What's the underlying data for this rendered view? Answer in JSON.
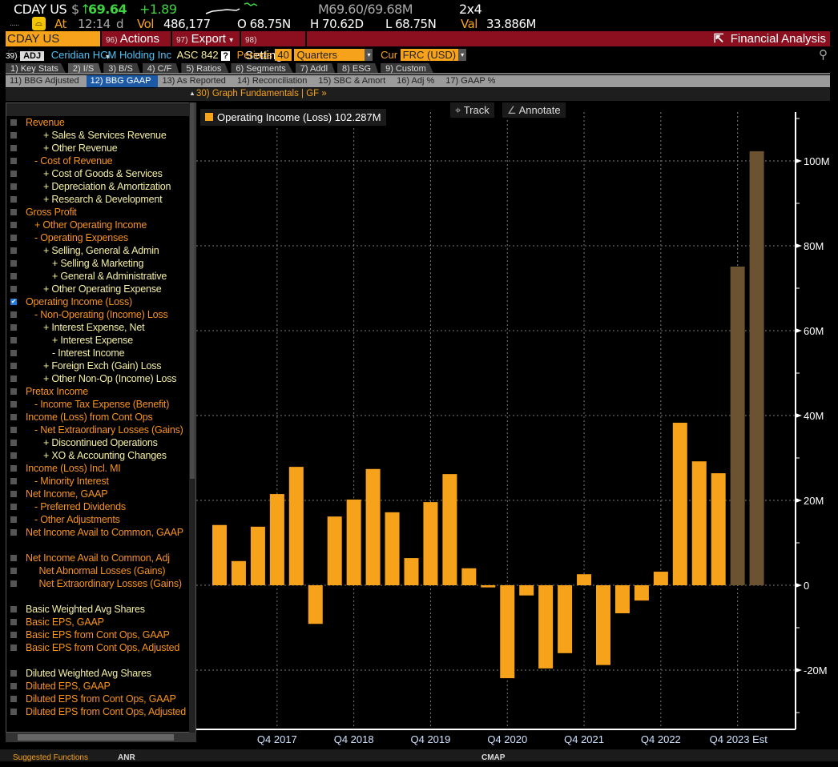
{
  "quote": {
    "ticker": "CDAY US",
    "currency_symbol": "$",
    "last": "69.64",
    "change": "+1.89",
    "bid_ask": "M69.60/69.68M",
    "size": "2x4",
    "time_label": "At",
    "time": "12:14",
    "time_suffix": "d",
    "vol_label": "Vol",
    "volume": "486,177",
    "open": "O 68.75N",
    "high": "H 70.62D",
    "low": "L 68.75N",
    "val_label": "Val",
    "value": "33.886M"
  },
  "toolbar": {
    "security": "CDAY US Equity",
    "actions_num": "96)",
    "actions": "Actions",
    "export_num": "97)",
    "export": "Export",
    "settings_num": "98)",
    "settings": "Settings",
    "fa": "Financial Analysis"
  },
  "info": {
    "num": "39)",
    "adj": "ADJ",
    "company": "Ceridian HCM Holding Inc",
    "asc": "ASC 842",
    "help": "?",
    "periods_label": "Periods",
    "periods": "40",
    "period_type": "Quarters",
    "cur_label": "Cur",
    "currency": "FRC (USD)"
  },
  "tabs": [
    "1) Key Stats",
    "2) I/S",
    "3) B/S",
    "4) C/F",
    "5) Ratios",
    "6) Segments",
    "7) Addl",
    "8) ESG",
    "9) Custom"
  ],
  "active_tab": 1,
  "subtabs": [
    "11) BBG Adjusted",
    "12) BBG GAAP",
    "13) As Reported",
    "14) Reconciliation",
    "15) SBC & Amort",
    "16) Adj %",
    "17) GAAP %"
  ],
  "active_subtab": 1,
  "graph_link": "30) Graph Fundamentals | GF »",
  "sidebar": [
    {
      "label": "Revenue",
      "lvl": 0,
      "c": "or"
    },
    {
      "label": "+ Sales & Services Revenue",
      "lvl": 2,
      "c": "ye"
    },
    {
      "label": "+ Other Revenue",
      "lvl": 2,
      "c": "ye"
    },
    {
      "label": "- Cost of Revenue",
      "lvl": 1,
      "c": "or"
    },
    {
      "label": "+ Cost of Goods & Services",
      "lvl": 2,
      "c": "ye"
    },
    {
      "label": "+ Depreciation & Amortization",
      "lvl": 2,
      "c": "ye"
    },
    {
      "label": "+ Research & Development",
      "lvl": 2,
      "c": "ye"
    },
    {
      "label": "Gross Profit",
      "lvl": 0,
      "c": "or"
    },
    {
      "label": "+ Other Operating Income",
      "lvl": 1,
      "c": "or"
    },
    {
      "label": "- Operating Expenses",
      "lvl": 1,
      "c": "or"
    },
    {
      "label": "+ Selling, General & Admin",
      "lvl": 2,
      "c": "ye"
    },
    {
      "label": "+ Selling & Marketing",
      "lvl": 3,
      "c": "ye"
    },
    {
      "label": "+ General & Administrative",
      "lvl": 3,
      "c": "ye"
    },
    {
      "label": "+ Other Operating Expense",
      "lvl": 2,
      "c": "ye"
    },
    {
      "label": "Operating Income (Loss)",
      "lvl": 0,
      "c": "or",
      "checked": true
    },
    {
      "label": "- Non-Operating (Income) Loss",
      "lvl": 1,
      "c": "or"
    },
    {
      "label": "+ Interest Expense, Net",
      "lvl": 2,
      "c": "ye"
    },
    {
      "label": "+ Interest Expense",
      "lvl": 3,
      "c": "ye"
    },
    {
      "label": "- Interest Income",
      "lvl": 3,
      "c": "ye"
    },
    {
      "label": "+ Foreign Exch (Gain) Loss",
      "lvl": 2,
      "c": "ye"
    },
    {
      "label": "+ Other Non-Op (Income) Loss",
      "lvl": 2,
      "c": "ye"
    },
    {
      "label": "Pretax Income",
      "lvl": 0,
      "c": "or"
    },
    {
      "label": "- Income Tax Expense (Benefit)",
      "lvl": 1,
      "c": "or"
    },
    {
      "label": "Income (Loss) from Cont Ops",
      "lvl": 0,
      "c": "or"
    },
    {
      "label": "- Net Extraordinary Losses (Gains)",
      "lvl": 1,
      "c": "or"
    },
    {
      "label": "+ Discontinued Operations",
      "lvl": 2,
      "c": "ye"
    },
    {
      "label": "+ XO & Accounting Changes",
      "lvl": 2,
      "c": "ye"
    },
    {
      "label": "Income (Loss) Incl. MI",
      "lvl": 0,
      "c": "or"
    },
    {
      "label": "- Minority Interest",
      "lvl": 1,
      "c": "or"
    },
    {
      "label": "Net Income, GAAP",
      "lvl": 0,
      "c": "or"
    },
    {
      "label": "- Preferred Dividends",
      "lvl": 1,
      "c": "or"
    },
    {
      "label": "- Other Adjustments",
      "lvl": 1,
      "c": "or"
    },
    {
      "label": "Net Income Avail to Common, GAAP",
      "lvl": 0,
      "c": "or"
    },
    null,
    {
      "label": "Net Income Avail to Common, Adj",
      "lvl": 0,
      "c": "or"
    },
    {
      "label": "Net Abnormal Losses (Gains)",
      "lvl": 1.5,
      "c": "or"
    },
    {
      "label": "Net Extraordinary Losses (Gains)",
      "lvl": 1.5,
      "c": "or"
    },
    null,
    {
      "label": "Basic Weighted Avg Shares",
      "lvl": 0,
      "c": "ye"
    },
    {
      "label": "Basic EPS, GAAP",
      "lvl": 0,
      "c": "or"
    },
    {
      "label": "Basic EPS from Cont Ops, GAAP",
      "lvl": 0,
      "c": "or"
    },
    {
      "label": "Basic EPS from Cont Ops, Adjusted",
      "lvl": 0,
      "c": "or"
    },
    null,
    {
      "label": "Diluted Weighted Avg Shares",
      "lvl": 0,
      "c": "ye"
    },
    {
      "label": "Diluted EPS, GAAP",
      "lvl": 0,
      "c": "or"
    },
    {
      "label": "Diluted EPS from Cont Ops, GAAP",
      "lvl": 0,
      "c": "or"
    },
    {
      "label": "Diluted EPS from Cont Ops, Adjusted",
      "lvl": 0,
      "c": "or"
    },
    null,
    {
      "label": "Reference Items",
      "lvl": 0,
      "c": "ye"
    }
  ],
  "chart_tools": {
    "track": "Track",
    "annotate": "Annotate"
  },
  "legend": {
    "label": "Operating Income (Loss)",
    "value": "102.287M"
  },
  "footer": [
    "Suggested Functions",
    "ANR",
    "CMAP"
  ],
  "chart_data": {
    "type": "bar",
    "categories": [
      "Q1 2017",
      "Q2 2017",
      "Q3 2017",
      "Q4 2017",
      "Q1 2018",
      "Q2 2018",
      "Q3 2018",
      "Q4 2018",
      "Q1 2019",
      "Q2 2019",
      "Q3 2019",
      "Q4 2019",
      "Q1 2020",
      "Q2 2020",
      "Q3 2020",
      "Q4 2020",
      "Q1 2021",
      "Q2 2021",
      "Q3 2021",
      "Q4 2021",
      "Q1 2022",
      "Q2 2022",
      "Q3 2022",
      "Q4 2022",
      "Q1 2023",
      "Q2 2023",
      "Q3 2023",
      "Q4 2023 Est",
      "Q1 2024 Est"
    ],
    "series": [
      {
        "name": "Operating Income (Loss)",
        "values": [
          14.2,
          5.7,
          13.8,
          21.5,
          27.9,
          -9.1,
          16.2,
          20.2,
          27.4,
          17.2,
          6.4,
          19.6,
          26.2,
          4.0,
          -0.5,
          -21.9,
          -2.4,
          -19.6,
          -16.0,
          2.6,
          -18.8,
          -6.6,
          -3.6,
          3.2,
          38.3,
          29.2,
          26.4,
          75.1,
          102.287
        ]
      }
    ],
    "estimate_from_index": 27,
    "x_tick_labels": [
      "Q4 2017",
      "Q4 2018",
      "Q4 2019",
      "Q4 2020",
      "Q4 2021",
      "Q4 2022",
      "Q4 2023 Est"
    ],
    "y_tick_labels": [
      "-20M",
      "0",
      "20M",
      "40M",
      "60M",
      "80M",
      "100M"
    ],
    "y_ticks": [
      -20,
      0,
      20,
      40,
      60,
      80,
      100
    ],
    "ylim": [
      -34,
      111
    ],
    "unit": "M",
    "grid": true,
    "colors": {
      "actual": "#f7a21b",
      "estimate": "#6b5331"
    },
    "legend_position": "top-left"
  }
}
